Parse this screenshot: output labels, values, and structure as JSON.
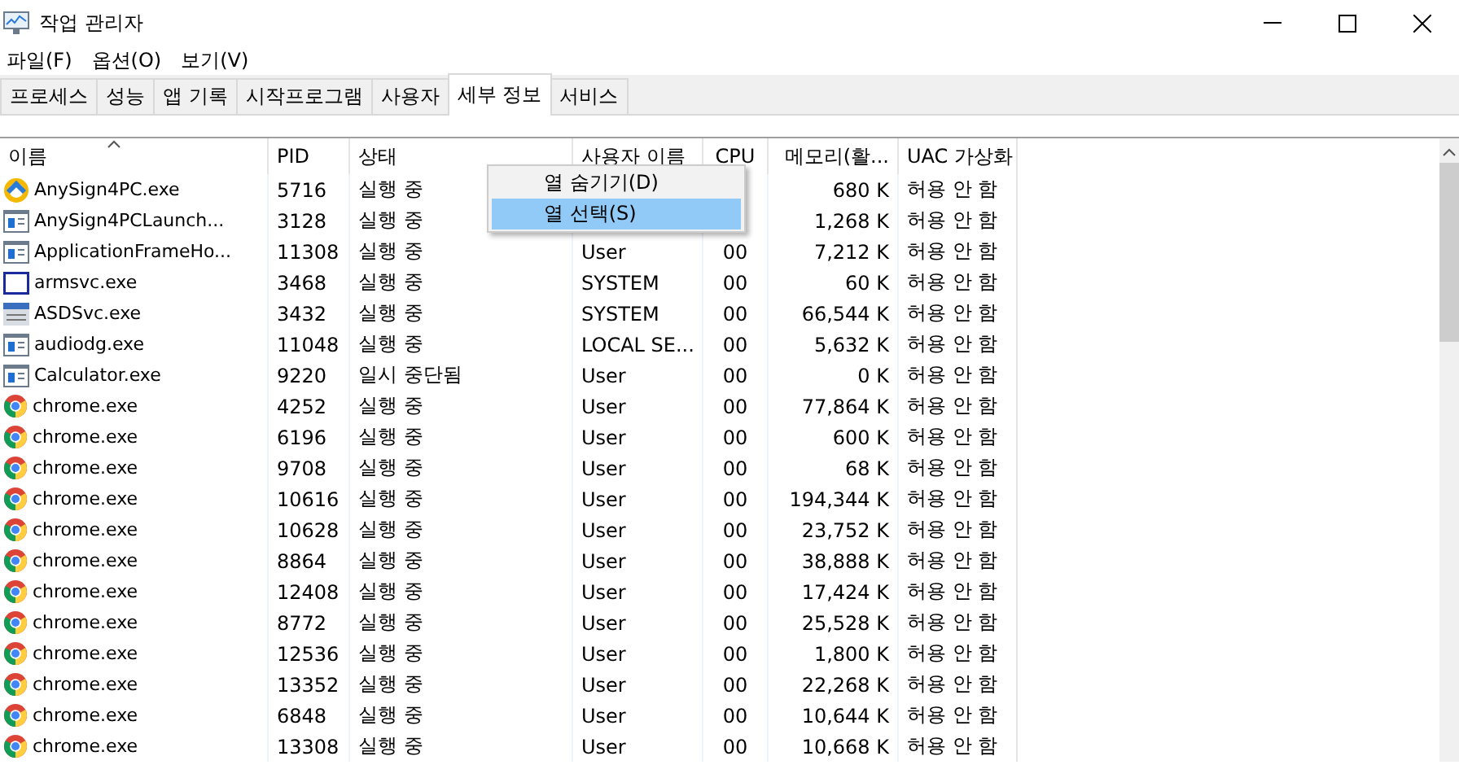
{
  "window": {
    "title": "작업 관리자"
  },
  "menu": [
    {
      "label": "파일(F)"
    },
    {
      "label": "옵션(O)"
    },
    {
      "label": "보기(V)"
    }
  ],
  "tabs": [
    {
      "label": "프로세스",
      "selected": false
    },
    {
      "label": "성능",
      "selected": false
    },
    {
      "label": "앱 기록",
      "selected": false
    },
    {
      "label": "시작프로그램",
      "selected": false
    },
    {
      "label": "사용자",
      "selected": false
    },
    {
      "label": "세부 정보",
      "selected": true
    },
    {
      "label": "서비스",
      "selected": false
    }
  ],
  "table": {
    "columns": [
      "이름",
      "PID",
      "상태",
      "사용자 이름",
      "CPU",
      "메모리(활...",
      "UAC 가상화"
    ],
    "rows": [
      {
        "kind": "anysign",
        "name": "AnySign4PC.exe",
        "pid": "5716",
        "status": "실행 중",
        "memory": "680 K",
        "uac": "허용 안 함"
      },
      {
        "kind": "window",
        "name": "AnySign4PCLaunch...",
        "pid": "3128",
        "status": "실행 중",
        "memory": "1,268 K",
        "uac": "허용 안 함"
      },
      {
        "kind": "window",
        "name": "ApplicationFrameHo...",
        "pid": "11308",
        "status": "실행 중",
        "user": "User",
        "cpu": "00",
        "memory": "7,212 K",
        "uac": "허용 안 함"
      },
      {
        "kind": "frame",
        "name": "armsvc.exe",
        "pid": "3468",
        "status": "실행 중",
        "user": "SYSTEM",
        "cpu": "00",
        "memory": "60 K",
        "uac": "허용 안 함"
      },
      {
        "kind": "service",
        "name": "ASDSvc.exe",
        "pid": "3432",
        "status": "실행 중",
        "user": "SYSTEM",
        "cpu": "00",
        "memory": "66,544 K",
        "uac": "허용 안 함"
      },
      {
        "kind": "window",
        "name": "audiodg.exe",
        "pid": "11048",
        "status": "실행 중",
        "user": "LOCAL SE...",
        "cpu": "00",
        "memory": "5,632 K",
        "uac": "허용 안 함"
      },
      {
        "kind": "window",
        "name": "Calculator.exe",
        "pid": "9220",
        "status": "일시 중단됨",
        "user": "User",
        "cpu": "00",
        "memory": "0 K",
        "uac": "허용 안 함"
      },
      {
        "kind": "chrome",
        "name": "chrome.exe",
        "pid": "4252",
        "status": "실행 중",
        "user": "User",
        "cpu": "00",
        "memory": "77,864 K",
        "uac": "허용 안 함"
      },
      {
        "kind": "chrome",
        "name": "chrome.exe",
        "pid": "6196",
        "status": "실행 중",
        "user": "User",
        "cpu": "00",
        "memory": "600 K",
        "uac": "허용 안 함"
      },
      {
        "kind": "chrome",
        "name": "chrome.exe",
        "pid": "9708",
        "status": "실행 중",
        "user": "User",
        "cpu": "00",
        "memory": "68 K",
        "uac": "허용 안 함"
      },
      {
        "kind": "chrome",
        "name": "chrome.exe",
        "pid": "10616",
        "status": "실행 중",
        "user": "User",
        "cpu": "00",
        "memory": "194,344 K",
        "uac": "허용 안 함"
      },
      {
        "kind": "chrome",
        "name": "chrome.exe",
        "pid": "10628",
        "status": "실행 중",
        "user": "User",
        "cpu": "00",
        "memory": "23,752 K",
        "uac": "허용 안 함"
      },
      {
        "kind": "chrome",
        "name": "chrome.exe",
        "pid": "8864",
        "status": "실행 중",
        "user": "User",
        "cpu": "00",
        "memory": "38,888 K",
        "uac": "허용 안 함"
      },
      {
        "kind": "chrome",
        "name": "chrome.exe",
        "pid": "12408",
        "status": "실행 중",
        "user": "User",
        "cpu": "00",
        "memory": "17,424 K",
        "uac": "허용 안 함"
      },
      {
        "kind": "chrome",
        "name": "chrome.exe",
        "pid": "8772",
        "status": "실행 중",
        "user": "User",
        "cpu": "00",
        "memory": "25,528 K",
        "uac": "허용 안 함"
      },
      {
        "kind": "chrome",
        "name": "chrome.exe",
        "pid": "12536",
        "status": "실행 중",
        "user": "User",
        "cpu": "00",
        "memory": "1,800 K",
        "uac": "허용 안 함"
      },
      {
        "kind": "chrome",
        "name": "chrome.exe",
        "pid": "13352",
        "status": "실행 중",
        "user": "User",
        "cpu": "00",
        "memory": "22,268 K",
        "uac": "허용 안 함"
      },
      {
        "kind": "chrome",
        "name": "chrome.exe",
        "pid": "6848",
        "status": "실행 중",
        "user": "User",
        "cpu": "00",
        "memory": "10,644 K",
        "uac": "허용 안 함"
      },
      {
        "kind": "chrome",
        "name": "chrome.exe",
        "pid": "13308",
        "status": "실행 중",
        "user": "User",
        "cpu": "00",
        "memory": "10,668 K",
        "uac": "허용 안 함"
      }
    ]
  },
  "context_menu": [
    {
      "label": "열 숨기기(D)",
      "selected": false
    },
    {
      "label": "열 선택(S)",
      "selected": true
    }
  ]
}
